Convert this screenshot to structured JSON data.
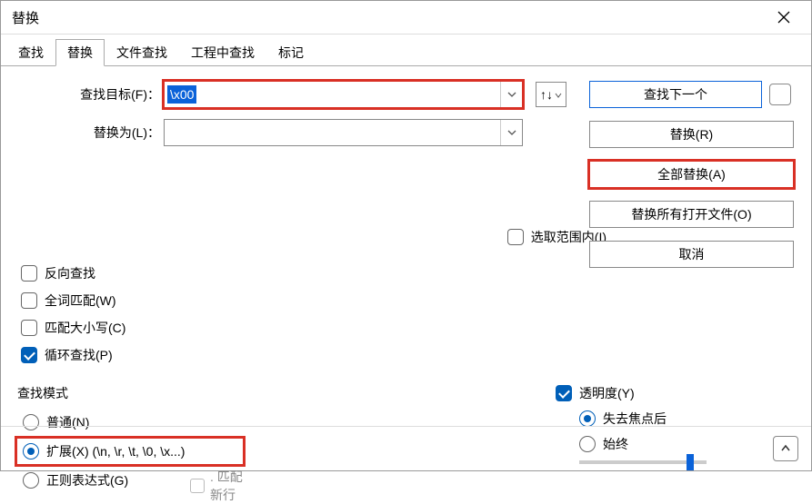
{
  "title": "替换",
  "tabs": [
    "查找",
    "替换",
    "文件查找",
    "工程中查找",
    "标记"
  ],
  "active_tab": 1,
  "find": {
    "label": "查找目标(F)：",
    "value": "\\x00"
  },
  "replace": {
    "label": "替换为(L)：",
    "value": ""
  },
  "swap_icon": "↑↓",
  "in_selection": "选取范围内(I)",
  "buttons": {
    "find_next": "查找下一个",
    "replace": "替换(R)",
    "replace_all": "全部替换(A)",
    "replace_all_open": "替换所有打开文件(O)",
    "cancel": "取消"
  },
  "options": {
    "backward": "反向查找",
    "whole_word": "全词匹配(W)",
    "match_case": "匹配大小写(C)",
    "wrap": "循环查找(P)"
  },
  "mode": {
    "title": "查找模式",
    "normal": "普通(N)",
    "extended": "扩展(X) (\\n, \\r, \\t, \\0, \\x...)",
    "regex": "正则表达式(G)",
    "newline": ". 匹配新行"
  },
  "transparency": {
    "title": "透明度(Y)",
    "on_blur": "失去焦点后",
    "always": "始终"
  }
}
